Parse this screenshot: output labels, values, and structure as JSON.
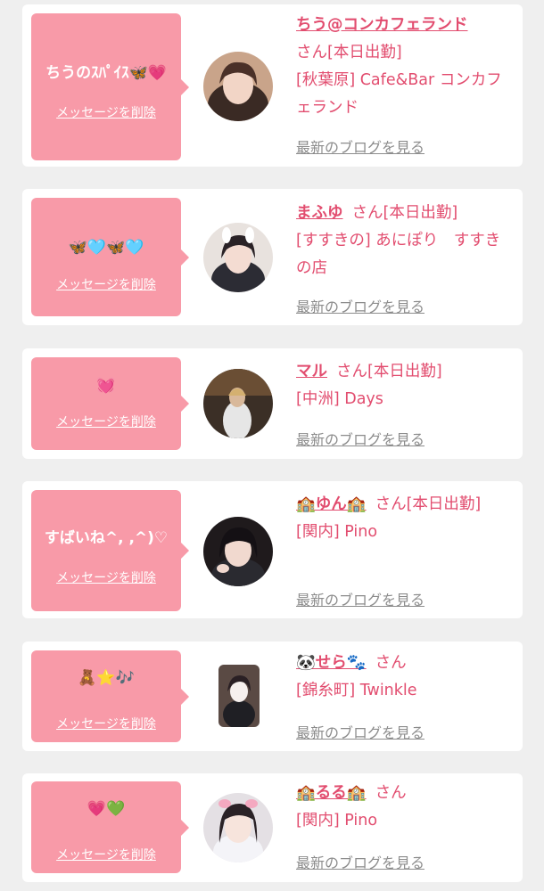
{
  "common": {
    "delete_label": "メッセージを削除",
    "blog_label": "最新のブログを見る",
    "san": "さん"
  },
  "items": [
    {
      "message": "ちうのｽﾊﾟｲｽ🦋💗",
      "name": "ちう@コンカフェランド",
      "status": "[本日出勤]",
      "shop": "[秋葉原] Cafe&Bar コンカフェランド"
    },
    {
      "message": "🦋🩵🦋🩵",
      "name": "まふゆ",
      "status": "[本日出勤]",
      "shop": "[すすきの] あにぽり　すすきの店"
    },
    {
      "message": "💓",
      "name": "マル",
      "status": "[本日出勤]",
      "shop": "[中洲] Days"
    },
    {
      "message": "すばいね^, ,^)♡",
      "name": "🏫ゆん🏫",
      "status": "[本日出勤]",
      "shop": "[関内] Pino"
    },
    {
      "message": "🧸⭐🎶",
      "name": "🐼せら🐾",
      "status": "",
      "shop": "[錦糸町] Twinkle"
    },
    {
      "message": "💗💚",
      "name": "🏫るる🏫",
      "status": "",
      "shop": "[関内] Pino"
    }
  ],
  "colors": {
    "page_bg": "#efefef",
    "card_bg": "#ffffff",
    "bubble_bg": "#f89aa8",
    "accent_text": "#e24d6f",
    "link_gray": "#8c8c8c"
  }
}
